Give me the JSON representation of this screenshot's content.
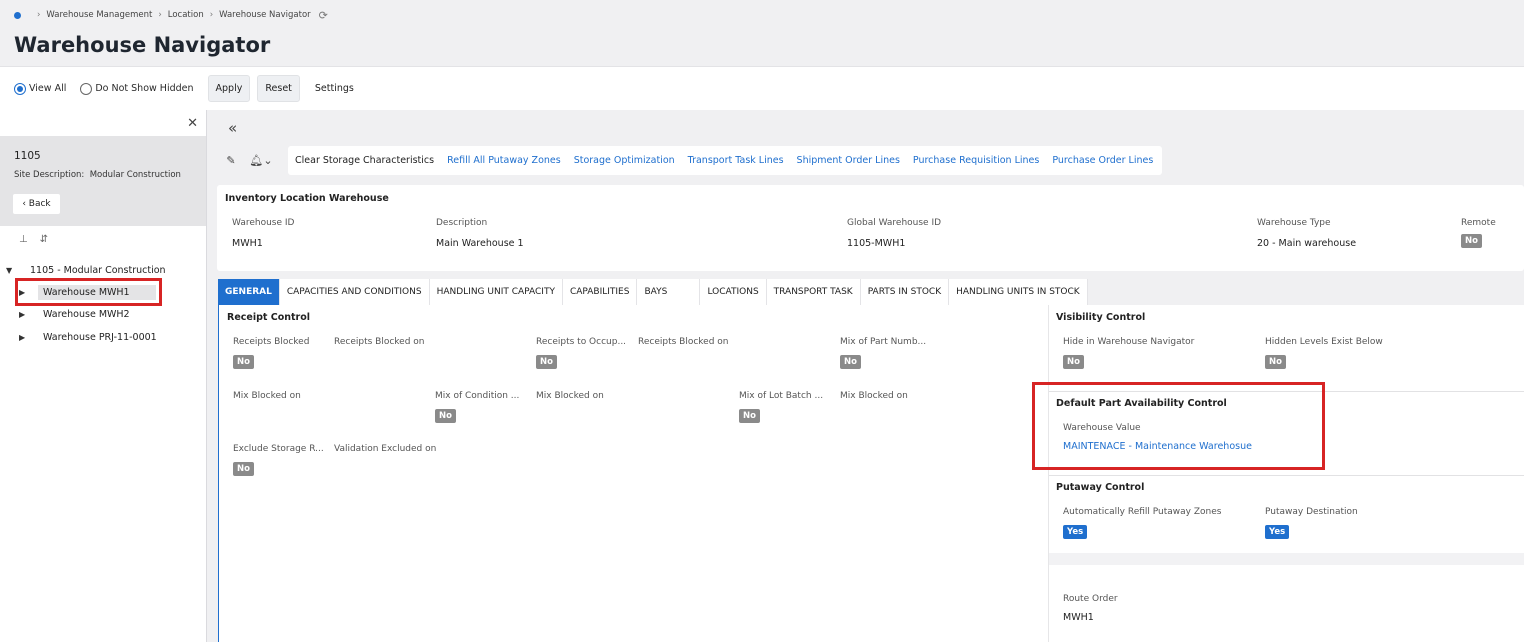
{
  "breadcrumb": {
    "items": [
      "Warehouse Management",
      "Location",
      "Warehouse Navigator"
    ]
  },
  "page": {
    "title": "Warehouse Navigator"
  },
  "filters": {
    "view_all": "View All",
    "do_not_show_hidden": "Do Not Show Hidden",
    "apply": "Apply",
    "reset": "Reset",
    "settings": "Settings"
  },
  "left_panel": {
    "site_id": "1105",
    "site_description_label": "Site Description:",
    "site_description": "Modular Construction",
    "back": "Back",
    "tree": {
      "root": "1105 - Modular Construction",
      "items": [
        "Warehouse MWH1",
        "Warehouse MWH2",
        "Warehouse PRJ-11-0001"
      ]
    }
  },
  "commands": {
    "clear_storage": "Clear Storage Characteristics",
    "links": [
      "Refill All Putaway Zones",
      "Storage Optimization",
      "Transport Task Lines",
      "Shipment Order Lines",
      "Purchase Requisition Lines",
      "Purchase Order Lines"
    ]
  },
  "header": {
    "title": "Inventory Location Warehouse",
    "warehouse_id_label": "Warehouse ID",
    "warehouse_id": "MWH1",
    "description_label": "Description",
    "description": "Main Warehouse 1",
    "global_id_label": "Global Warehouse ID",
    "global_id": "1105-MWH1",
    "type_label": "Warehouse Type",
    "type": "20 - Main warehouse",
    "remote_label": "Remote",
    "remote": "No"
  },
  "tabs": [
    "GENERAL",
    "CAPACITIES AND CONDITIONS",
    "HANDLING UNIT CAPACITY",
    "CAPABILITIES",
    "BAYS",
    "LOCATIONS",
    "TRANSPORT TASK",
    "PARTS IN STOCK",
    "HANDLING UNITS IN STOCK"
  ],
  "receipt_control": {
    "title": "Receipt Control",
    "receipts_blocked": "Receipts Blocked",
    "receipts_blocked_val": "No",
    "receipts_blocked_on": "Receipts Blocked on",
    "receipts_to_occupied": "Receipts to Occup...",
    "receipts_to_occupied_val": "No",
    "receipts_blocked_on_2": "Receipts Blocked on",
    "mix_part_numbers": "Mix of Part Numb...",
    "mix_part_numbers_val": "No",
    "mix_blocked_on": "Mix Blocked on",
    "mix_condition": "Mix of Condition ...",
    "mix_condition_val": "No",
    "mix_blocked_on_2": "Mix Blocked on",
    "mix_lot_batch": "Mix of Lot Batch ...",
    "mix_lot_batch_val": "No",
    "mix_blocked_on_3": "Mix Blocked on",
    "exclude_storage": "Exclude Storage R...",
    "exclude_storage_val": "No",
    "validation_excluded_on": "Validation Excluded on"
  },
  "visibility_control": {
    "title": "Visibility Control",
    "hide_label": "Hide in Warehouse Navigator",
    "hide_val": "No",
    "hidden_levels_label": "Hidden Levels Exist Below",
    "hidden_levels_val": "No"
  },
  "default_part_availability": {
    "title": "Default Part Availability Control",
    "warehouse_value_label": "Warehouse Value",
    "warehouse_value": "MAINTENACE - Maintenance Warehosue"
  },
  "putaway_control": {
    "title": "Putaway Control",
    "auto_refill_label": "Automatically Refill Putaway Zones",
    "auto_refill_val": "Yes",
    "destination_label": "Putaway Destination",
    "destination_val": "Yes"
  },
  "route": {
    "label": "Route Order",
    "value": "MWH1"
  },
  "colors": {
    "accent": "#1f6fce",
    "highlight": "#d72424",
    "badge_no": "#8a8a8a"
  }
}
